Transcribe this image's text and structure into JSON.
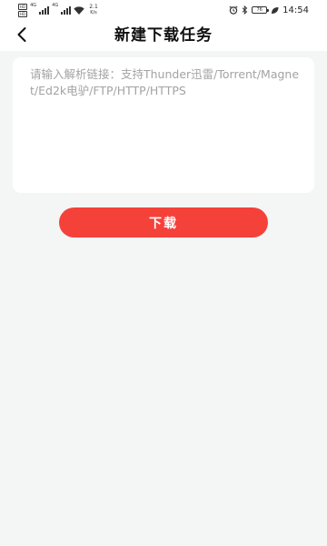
{
  "status_bar": {
    "sim1_tag": "HD",
    "sim1_net": "4G",
    "sim2_tag": "HD",
    "sim2_net": "4G",
    "speed_value": "2.1",
    "speed_unit": "K/s",
    "battery_level": "76",
    "time": "14:54",
    "icons": [
      "signal-icon",
      "wifi-icon",
      "alarm-icon",
      "bluetooth-icon",
      "battery-icon",
      "leaf-icon"
    ]
  },
  "header": {
    "title": "新建下载任务",
    "back_icon": "chevron-left-icon"
  },
  "link_input": {
    "value": "",
    "placeholder": "请输入解析链接：支持Thunder迅雷/Torrent/Magnet/Ed2k电驴/FTP/HTTP/HTTPS"
  },
  "actions": {
    "download_label": "下载"
  },
  "colors": {
    "accent": "#f4413a",
    "background": "#f4f5f5",
    "card": "#ffffff",
    "placeholder": "#a3a3a3"
  }
}
